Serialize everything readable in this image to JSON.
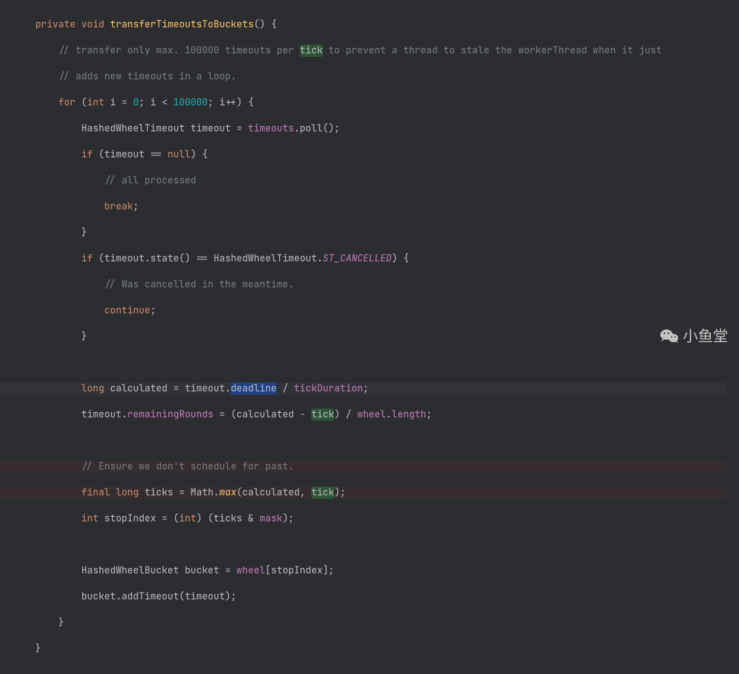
{
  "code": {
    "l1_kw1": "private",
    "l1_kw2": "void",
    "l1_mname": "transferTimeoutsToBuckets",
    "l1_p1": "() {",
    "l2_comment_a": "// transfer only max. 100000 timeouts per ",
    "l2_hl": "tick",
    "l2_comment_b": " to prevent a thread to stale the workerThread when it just",
    "l3_comment": "// adds new timeouts in a loop.",
    "l4_kw": "for",
    "l4_p1": " (",
    "l4_kw2": "int",
    "l4_var": " i",
    "l4_p2": " = ",
    "l4_num0": "0",
    "l4_p3": "; i < ",
    "l4_num1": "100000",
    "l4_p4": "; i++) {",
    "l5_type": "HashedWheelTimeout",
    "l5_var": " timeout",
    "l5_p1": " = ",
    "l5_field": "timeouts",
    "l5_p2": ".poll();",
    "l6_kw": "if",
    "l6_p1": " (timeout == ",
    "l6_kw2": "null",
    "l6_p2": ") {",
    "l7_comment": "// all processed",
    "l8_kw": "break",
    "l8_p": ";",
    "l9_p": "}",
    "l10_kw": "if",
    "l10_p1": " (timeout.state() == HashedWheelTimeout.",
    "l10_sf": "ST_CANCELLED",
    "l10_p2": ") {",
    "l11_comment": "// Was cancelled in the meantime.",
    "l12_kw": "continue",
    "l12_p": ";",
    "l13_p": "}",
    "l15_kw": "long",
    "l15_var": " calculated",
    "l15_p1": " = timeout.",
    "l15_sel": "deadline",
    "l15_p2": " / ",
    "l15_field": "tickDuration",
    "l15_p3": ";",
    "l16_p1": "timeout.",
    "l16_field": "remainingRounds",
    "l16_p2": " = (calculated - ",
    "l16_hl": "tick",
    "l16_p3": ") / ",
    "l16_field2": "wheel",
    "l16_p4": ".",
    "l16_field3": "length",
    "l16_p5": ";",
    "l18_comment": "// Ensure we don't schedule for past.",
    "l19_kw1": "final",
    "l19_kw2": " long",
    "l19_var": " ticks",
    "l19_p1": " = Math.",
    "l19_sm": "max",
    "l19_p2": "(calculated, ",
    "l19_hl": "tick",
    "l19_p3": ");",
    "l20_kw": "int",
    "l20_var": " stopIndex",
    "l20_p1": " = (",
    "l20_kw2": "int",
    "l20_p2": ") (ticks & ",
    "l20_field": "mask",
    "l20_p3": ");",
    "l22_type": "HashedWheelBucket",
    "l22_var": " bucket",
    "l22_p1": " = ",
    "l22_field": "wheel",
    "l22_p2": "[stopIndex];",
    "l23_p1": "bucket.addTimeout(timeout);",
    "l24_p": "}",
    "l25_p": "}"
  },
  "watermark": {
    "text": "小鱼堂",
    "icon": "wechat-icon"
  }
}
